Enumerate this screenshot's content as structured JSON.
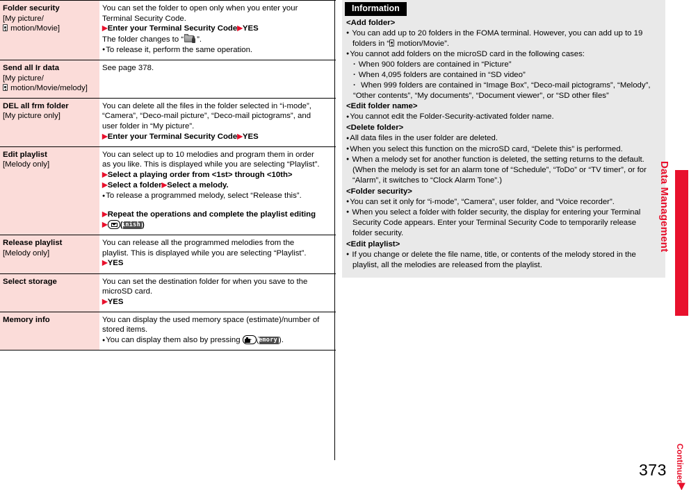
{
  "page": {
    "number": "373",
    "continued_label": "Continued",
    "continued_arrow": "▶",
    "side_tab_label": "Data Management",
    "accent_color": "#e8112d",
    "name_cell_bg": "#fbdcd9",
    "info_bg": "#e9e9e9"
  },
  "function_table": {
    "rows": [
      {
        "name": "Folder security",
        "applies_to_pre": "[My picture/",
        "applies_to_icon": "imotion-icon",
        "applies_to_post": " motion/Movie]",
        "desc": {
          "line1": "You can set the folder to open only when you enter your",
          "line2": "Terminal Security Code.",
          "step1_a": "Enter your Terminal Security Code",
          "step1_b": "YES",
          "line3_pre": "The folder changes to “",
          "line3_icon": "folder-lock-icon",
          "line3_post": "”.",
          "bullet1": "To release it, perform the same operation."
        }
      },
      {
        "name": "Send all Ir data",
        "applies_to_pre": "[My picture/",
        "applies_to_icon": "imotion-icon",
        "applies_to_post": " motion/Movie/melody]",
        "desc": {
          "line1": "See page 378."
        }
      },
      {
        "name": "DEL all frm folder",
        "applies_to_pre": "[My picture only]",
        "desc": {
          "line1": "You can delete all the files in the folder selected in “i-mode”,",
          "line2": "“Camera”, “Deco-mail picture”, “Deco-mail pictograms”, and",
          "line3": "user folder in “My picture”.",
          "step1_a": "Enter your Terminal Security Code",
          "step1_b": "YES"
        }
      },
      {
        "name": "Edit playlist",
        "applies_to_pre": "[Melody only]",
        "desc": {
          "line1": "You can select up to 10 melodies and program them in order",
          "line2": "as you like. This is displayed while you are selecting “Playlist”.",
          "step1": "Select a playing order from <1st> through <10th>",
          "step2_a": "Select a folder",
          "step2_b": "Select a melody.",
          "bullet1": "To release a programmed melody, select “Release this”.",
          "step3": "Repeat the operations and complete the playlist editing",
          "step4_icon": "mail-key-icon",
          "step4_softkey": "Finish"
        }
      },
      {
        "name": "Release playlist",
        "applies_to_pre": "[Melody only]",
        "desc": {
          "line1": "You can release all the programmed melodies from the",
          "line2": "playlist. This is displayed while you are selecting “Playlist”.",
          "step1": "YES"
        }
      },
      {
        "name": "Select storage",
        "applies_to_pre": "",
        "desc": {
          "line1": "You can set the destination folder for when you save to the",
          "line2": "microSD card.",
          "step1": "YES"
        }
      },
      {
        "name": "Memory info",
        "applies_to_pre": "",
        "desc": {
          "line1": "You can display the used memory space (estimate)/number of",
          "line2": "stored items.",
          "bullet1_pre": "You can display them also by pressing ",
          "bullet1_icon": "camera-key-icon",
          "bullet1_softkey": "Memory",
          "bullet1_post": ")."
        }
      }
    ]
  },
  "information": {
    "header": "Information",
    "sections": [
      {
        "title": "<Add folder>",
        "items": [
          {
            "type": "bullet",
            "line1": "You can add up to 20 folders in the FOMA terminal. However, you can add up to 19",
            "line2_pre": "folders in “",
            "line2_icon": "imotion-icon",
            "line2_post": " motion/Movie”."
          },
          {
            "type": "bullet",
            "line1": "You cannot add folders on the microSD card in the following cases:"
          },
          {
            "type": "sub",
            "line1": "When 900 folders are contained in “Picture”"
          },
          {
            "type": "sub",
            "line1": "When 4,095 folders are contained in “SD video”"
          },
          {
            "type": "sub",
            "line1": "When 999 folders are contained in “Image Box”, “Deco-mail pictograms”, “Melody”,",
            "line2": "“Other contents”, “My documents”, “Document viewer”, or “SD other files”"
          }
        ]
      },
      {
        "title": "<Edit folder name>",
        "items": [
          {
            "type": "bullet",
            "line1": "You cannot edit the Folder-Security-activated folder name."
          }
        ]
      },
      {
        "title": "<Delete folder>",
        "items": [
          {
            "type": "bullet",
            "line1": "All data files in the user folder are deleted."
          },
          {
            "type": "bullet",
            "line1": "When you select this function on the microSD card, “Delete this” is performed."
          },
          {
            "type": "bullet",
            "line1": "When a melody set for another function is deleted, the setting returns to the default.",
            "line2": "(When the melody is set for an alarm tone of “Schedule”, “ToDo” or “TV timer”, or for",
            "line3": "“Alarm”, it switches to “Clock Alarm Tone”.)"
          }
        ]
      },
      {
        "title": "<Folder security>",
        "items": [
          {
            "type": "bullet",
            "line1": "You can set it only for “i-mode”, “Camera”, user folder, and “Voice recorder”."
          },
          {
            "type": "bullet",
            "line1": "When you select a folder with folder security, the display for entering your Terminal",
            "line2": "Security Code appears. Enter your Terminal Security Code to temporarily release",
            "line3": "folder security."
          }
        ]
      },
      {
        "title": "<Edit playlist>",
        "items": [
          {
            "type": "bullet",
            "line1": "If you change or delete the file name, title, or contents of the melody stored in the",
            "line2": "playlist, all the melodies are released from the playlist."
          }
        ]
      }
    ]
  }
}
